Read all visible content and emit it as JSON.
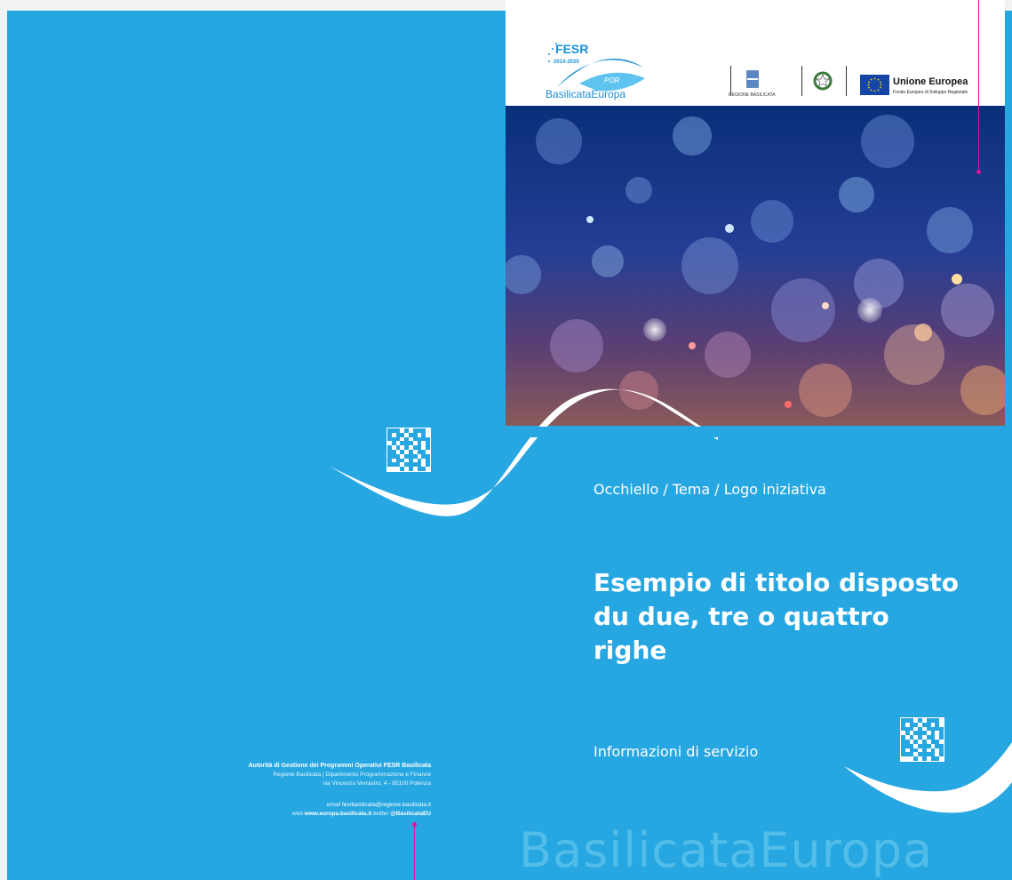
{
  "colors": {
    "brand_blue": "#27a7e1",
    "title_blue": "#1b8fd4",
    "marker_magenta": "#e0109a",
    "eu_blue": "#1546a6"
  },
  "header": {
    "fesr_logo": {
      "title": "FESR",
      "years": "2014-2020",
      "badge": "POR",
      "brand": "BasilicataEuropa"
    },
    "regione_label": "REGIONE BASILICATA",
    "italy_emblem_icon": "italian-republic-emblem-icon",
    "eu": {
      "title": "Unione Europea",
      "subtitle": "Fondo Europeo di Sviluppo Regionale"
    }
  },
  "cover": {
    "occhiello": "Occhiello / Tema / Logo iniziativa",
    "title": "Esempio di titolo disposto du due, tre o quattro righe",
    "info": "Informazioni di servizio",
    "watermark": "BasilicataEuropa"
  },
  "back": {
    "authority": "Autorità di Gestione dei Programmi Operativi FESR Basilicata",
    "department": "Regione Basilicata | Dipartimento Programmazione e Finanze",
    "address": "via Vincenzo Verrastro, 4 - 85100 Potenza",
    "email_label": "email",
    "email": "fesrbasilicata@regione.basilicata.it",
    "web_label": "web",
    "web": "www.europa.basilicata.it",
    "twitter_label": "twitter",
    "twitter": "@BasilicataEU"
  },
  "icons": {
    "qr": "qr-code-icon",
    "eu_flag": "eu-flag-icon",
    "regione": "regione-basilicata-crest-icon"
  }
}
